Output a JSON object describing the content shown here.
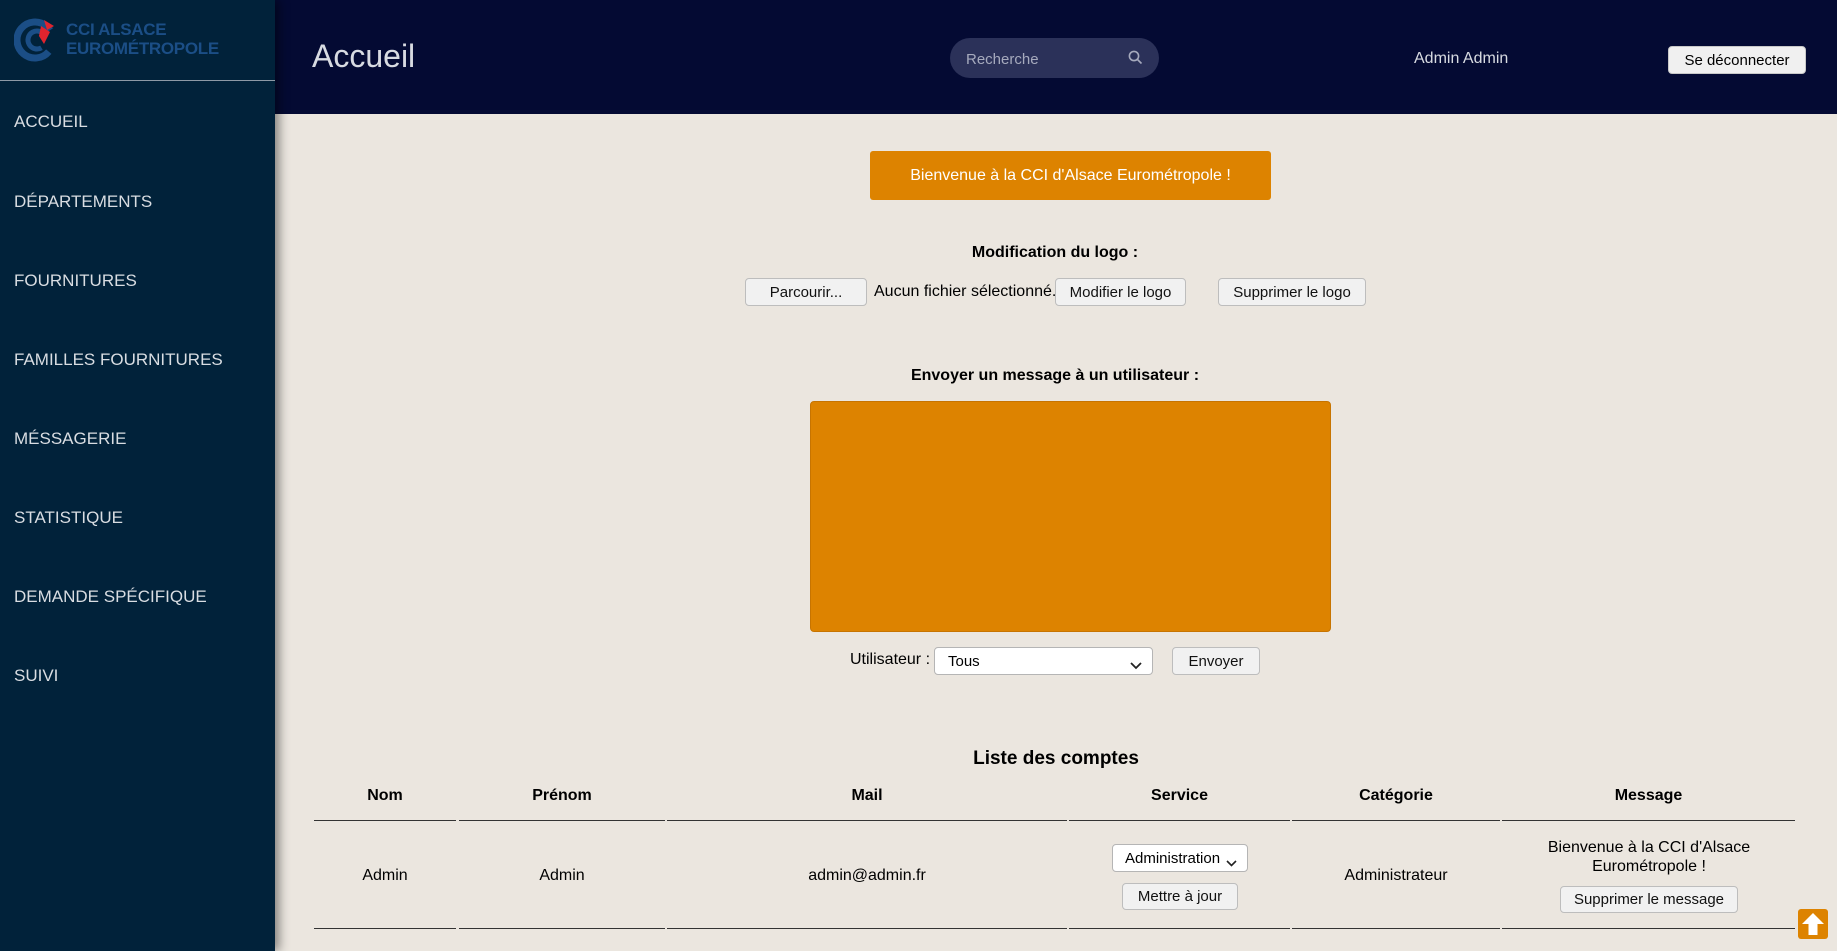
{
  "sidebar": {
    "logo": {
      "line1": "CCI ALSACE",
      "line2": "EUROMÉTROPOLE"
    },
    "items": [
      {
        "label": "ACCUEIL"
      },
      {
        "label": "DÉPARTEMENTS"
      },
      {
        "label": "FOURNITURES"
      },
      {
        "label": "FAMILLES FOURNITURES"
      },
      {
        "label": "MÉSSAGERIE"
      },
      {
        "label": "STATISTIQUE"
      },
      {
        "label": "DEMANDE SPÉCIFIQUE"
      },
      {
        "label": "SUIVI"
      }
    ]
  },
  "header": {
    "title": "Accueil",
    "search_placeholder": "Recherche",
    "user_name": "Admin Admin",
    "logout_label": "Se déconnecter"
  },
  "main": {
    "welcome": "Bienvenue à la CCI d'Alsace Eurométropole !",
    "logo_section": {
      "heading": "Modification du logo :",
      "browse_label": "Parcourir...",
      "no_file_text": "Aucun fichier sélectionné.",
      "modify_label": "Modifier le logo",
      "delete_label": "Supprimer le logo"
    },
    "message_section": {
      "heading": "Envoyer un message à un utilisateur :",
      "user_label": "Utilisateur :",
      "user_selected": "Tous",
      "send_label": "Envoyer"
    },
    "accounts": {
      "title": "Liste des comptes",
      "columns": [
        "Nom",
        "Prénom",
        "Mail",
        "Service",
        "Catégorie",
        "Message"
      ],
      "rows": [
        {
          "nom": "Admin",
          "prenom": "Admin",
          "mail": "admin@admin.fr",
          "service": "Administration",
          "update_label": "Mettre à jour",
          "categorie": "Administrateur",
          "message": "Bienvenue à la CCI d'Alsace Eurométropole !",
          "delete_message_label": "Supprimer le message"
        }
      ]
    }
  },
  "colors": {
    "sidebar_bg": "#01223a",
    "header_bg": "#040a33",
    "page_bg": "#ebe6df",
    "accent": "#dd8300"
  }
}
